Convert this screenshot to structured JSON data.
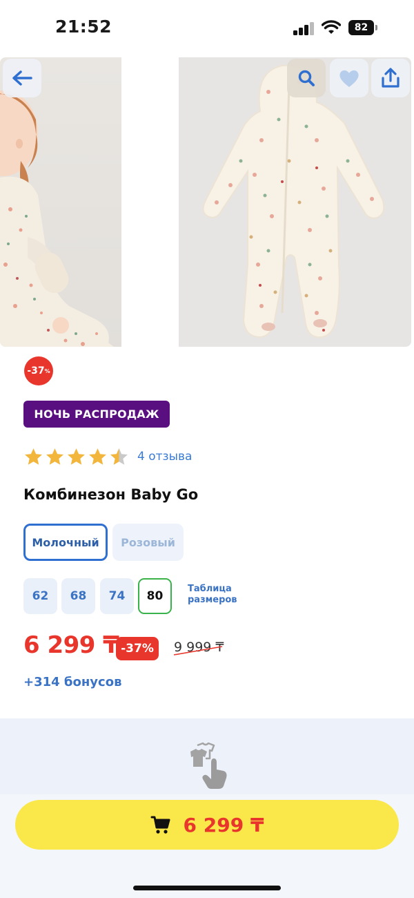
{
  "status_bar": {
    "time": "21:52",
    "battery": "82",
    "icons": [
      "signal-icon",
      "wifi-icon",
      "battery-icon"
    ]
  },
  "gallery": {
    "icons": [
      "back-arrow-icon",
      "search-icon",
      "heart-icon",
      "share-icon"
    ],
    "photos": [
      "baby-wearing-jumpsuit-photo",
      "jumpsuit-product-photo"
    ]
  },
  "discount_circle": {
    "value": "-37",
    "unit": "%"
  },
  "promo_badge": "НОЧЬ РАСПРОДАЖ",
  "rating": {
    "stars": 4.5,
    "max": 5,
    "reviews_label": "4 отзыва"
  },
  "product_title": "Комбинезон Baby Go",
  "colors": {
    "selected": "Молочный",
    "other": "Розовый"
  },
  "sizes": {
    "options": [
      "62",
      "68",
      "74",
      "80"
    ],
    "selected": "80",
    "table_link_line1": "Таблица",
    "table_link_line2": "размеров"
  },
  "price": {
    "current": "6 299 ₸",
    "discount": "-37%",
    "old": "9 999 ₸"
  },
  "bonuses": "+314 бонусов",
  "cart_button": {
    "price": "6 299 ₸",
    "icon": "cart-icon"
  },
  "theme": {
    "accent_blue": "#3a72c4",
    "sale_red": "#e8362c",
    "promo_purple": "#5a0f80",
    "cart_yellow": "#fae84a",
    "size_selected_green": "#39b24a",
    "star_gold": "#f3b63c"
  }
}
